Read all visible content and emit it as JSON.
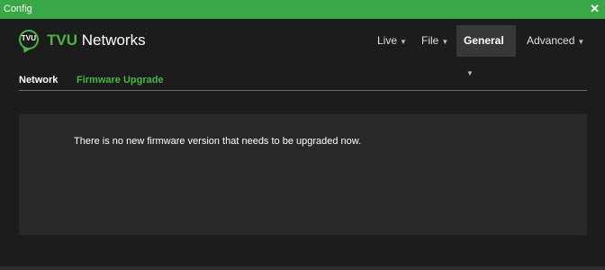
{
  "window": {
    "title": "Config",
    "close_glyph": "✕"
  },
  "logo": {
    "badge": "TVU",
    "brand": "TVU",
    "rest": "Networks",
    "tm": "·"
  },
  "nav": [
    {
      "label": "Live",
      "caret": "▼"
    },
    {
      "label": "File",
      "caret": "▼"
    },
    {
      "label": "General",
      "caret": "▼",
      "active": true
    },
    {
      "label": "Advanced",
      "caret": "▼"
    }
  ],
  "tabs": [
    {
      "label": "Network"
    },
    {
      "label": "Firmware Upgrade",
      "active": true
    }
  ],
  "panel": {
    "message": "There is no new firmware version that needs to be upgraded now."
  },
  "colors": {
    "accent": "#4bb543",
    "titlebar": "#37a845",
    "background": "#1c1c1c",
    "panel": "#282828"
  }
}
